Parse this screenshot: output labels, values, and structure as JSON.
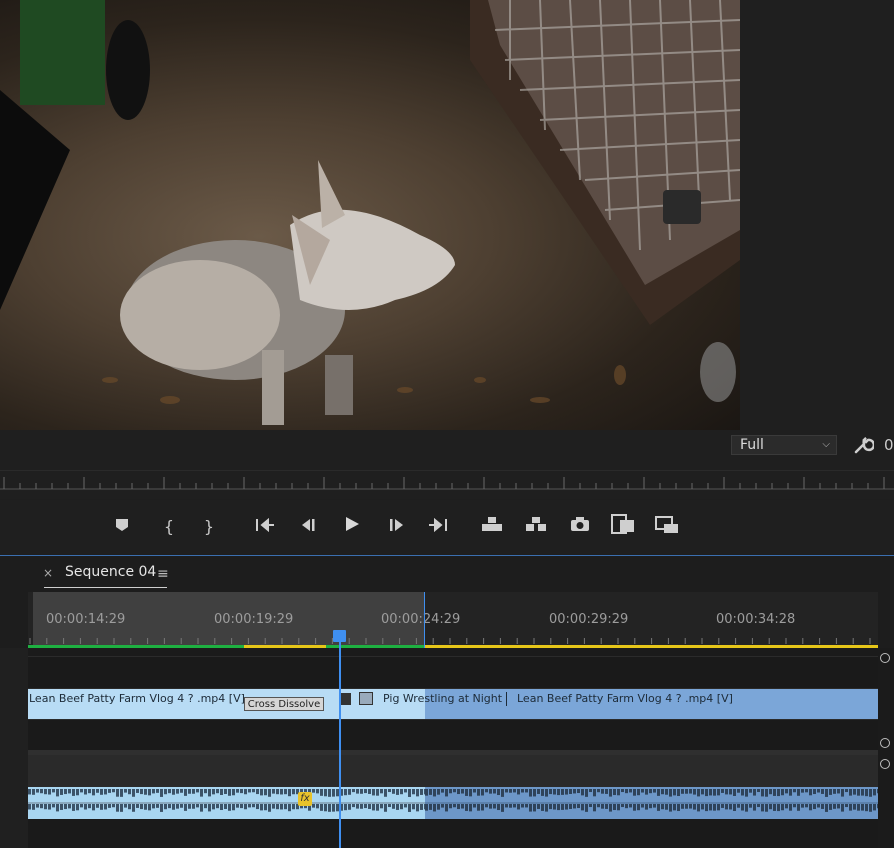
{
  "monitor": {
    "zoom_level": "Full",
    "resolution_partial": "0"
  },
  "transport": {
    "buttons": [
      "add-marker",
      "mark-in",
      "mark-out",
      "go-to-in",
      "step-back",
      "play",
      "step-forward",
      "go-to-out",
      "lift",
      "extract",
      "export-frame",
      "insert",
      "overwrite"
    ]
  },
  "sequence": {
    "tab_close": "×",
    "tab_title": "Sequence 04",
    "tab_menu": "≡"
  },
  "ruler": {
    "timecodes": [
      "00:00:14:29",
      "00:00:19:29",
      "00:00:24:29",
      "00:00:29:29",
      "00:00:34:28"
    ]
  },
  "video_track": {
    "clip1_label": "Lean Beef Patty Farm Vlog  4 ? .mp4 [V]",
    "transition_label": "Cross Dissolve",
    "clip2_title": "Pig Wrestling at Night",
    "clip2_label": "Lean Beef Patty Farm Vlog  4 ? .mp4 [V]"
  },
  "audio_track": {
    "fx_badge": "fx"
  },
  "colors": {
    "accent": "#3f8ff0",
    "render_green": "#1eb041",
    "render_yellow": "#e6c619",
    "video_clip": "#b8dcf5",
    "video_clip_selected": "#7ba6d8"
  }
}
